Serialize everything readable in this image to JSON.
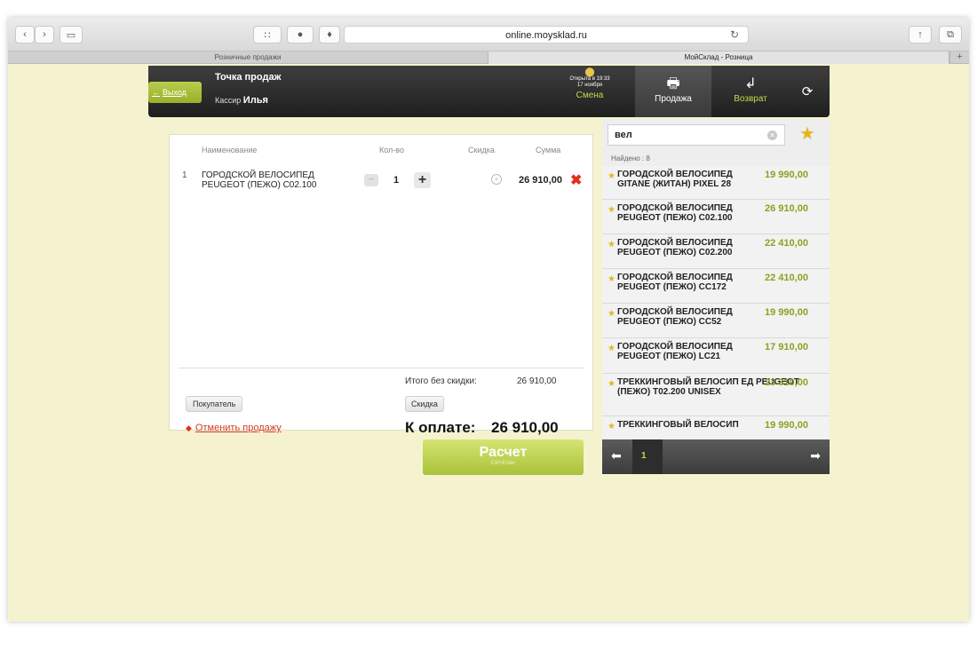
{
  "browser": {
    "url": "online.moysklad.ru",
    "tabs": [
      "Розничные продажи",
      "МойСклад - Розница"
    ]
  },
  "header": {
    "exit_label": "Выход",
    "point_title": "Точка продаж",
    "cashier_label": "Кассир",
    "cashier_name": "Илья",
    "shift_opened": "Открыта в 19:33",
    "shift_date": "17 ноября",
    "shift_label": "Смена",
    "sale_label": "Продажа",
    "return_label": "Возврат"
  },
  "cart": {
    "columns": {
      "name": "Наименование",
      "qty": "Кол-во",
      "discount": "Скидка",
      "sum": "Сумма"
    },
    "rows": [
      {
        "index": "1",
        "name": "ГОРОДСКОЙ ВЕЛОСИПЕД PEUGEOT (ПЕЖО) C02.100",
        "qty": "1",
        "sum": "26 910,00"
      }
    ],
    "total_label": "Итого без скидки:",
    "total_value": "26 910,00",
    "buyer_button": "Покупатель",
    "discount_button": "Скидка",
    "cancel_sale": "Отменить продажу",
    "to_pay_label": "К оплате:",
    "to_pay_value": "26 910,00"
  },
  "pay": {
    "label": "Расчет",
    "hint": "Ctrl+Enter"
  },
  "search": {
    "query": "вел",
    "found": "Найдено : 8",
    "results": [
      {
        "name": "ГОРОДСКОЙ ВЕЛОСИПЕД GITANE (ЖИТАН) PIXEL 28",
        "price": "19 990,00"
      },
      {
        "name": "ГОРОДСКОЙ ВЕЛОСИПЕД PEUGEOT (ПЕЖО) C02.100",
        "price": "26 910,00"
      },
      {
        "name": "ГОРОДСКОЙ ВЕЛОСИПЕД PEUGEOT (ПЕЖО) C02.200",
        "price": "22 410,00"
      },
      {
        "name": "ГОРОДСКОЙ ВЕЛОСИПЕД PEUGEOT (ПЕЖО) CC172",
        "price": "22 410,00"
      },
      {
        "name": "ГОРОДСКОЙ ВЕЛОСИПЕД PEUGEOT (ПЕЖО) CC52",
        "price": "19 990,00"
      },
      {
        "name": "ГОРОДСКОЙ ВЕЛОСИПЕД PEUGEOT (ПЕЖО) LC21",
        "price": "17 910,00"
      },
      {
        "name": "ТРЕККИНГОВЫЙ ВЕЛОСИП ЕД PEUGEOT (ПЕЖО) T02.200 UNISEX",
        "price": "23 310,00"
      },
      {
        "name": "ТРЕККИНГОВЫЙ ВЕЛОСИП",
        "price": "19 990,00"
      }
    ],
    "page": "1"
  },
  "colors": {
    "background": "#f5f3cf",
    "accent_green": "#a9c23a",
    "price_green": "#8aa21e",
    "delete_red": "#e0301e",
    "star": "#e5b520"
  }
}
